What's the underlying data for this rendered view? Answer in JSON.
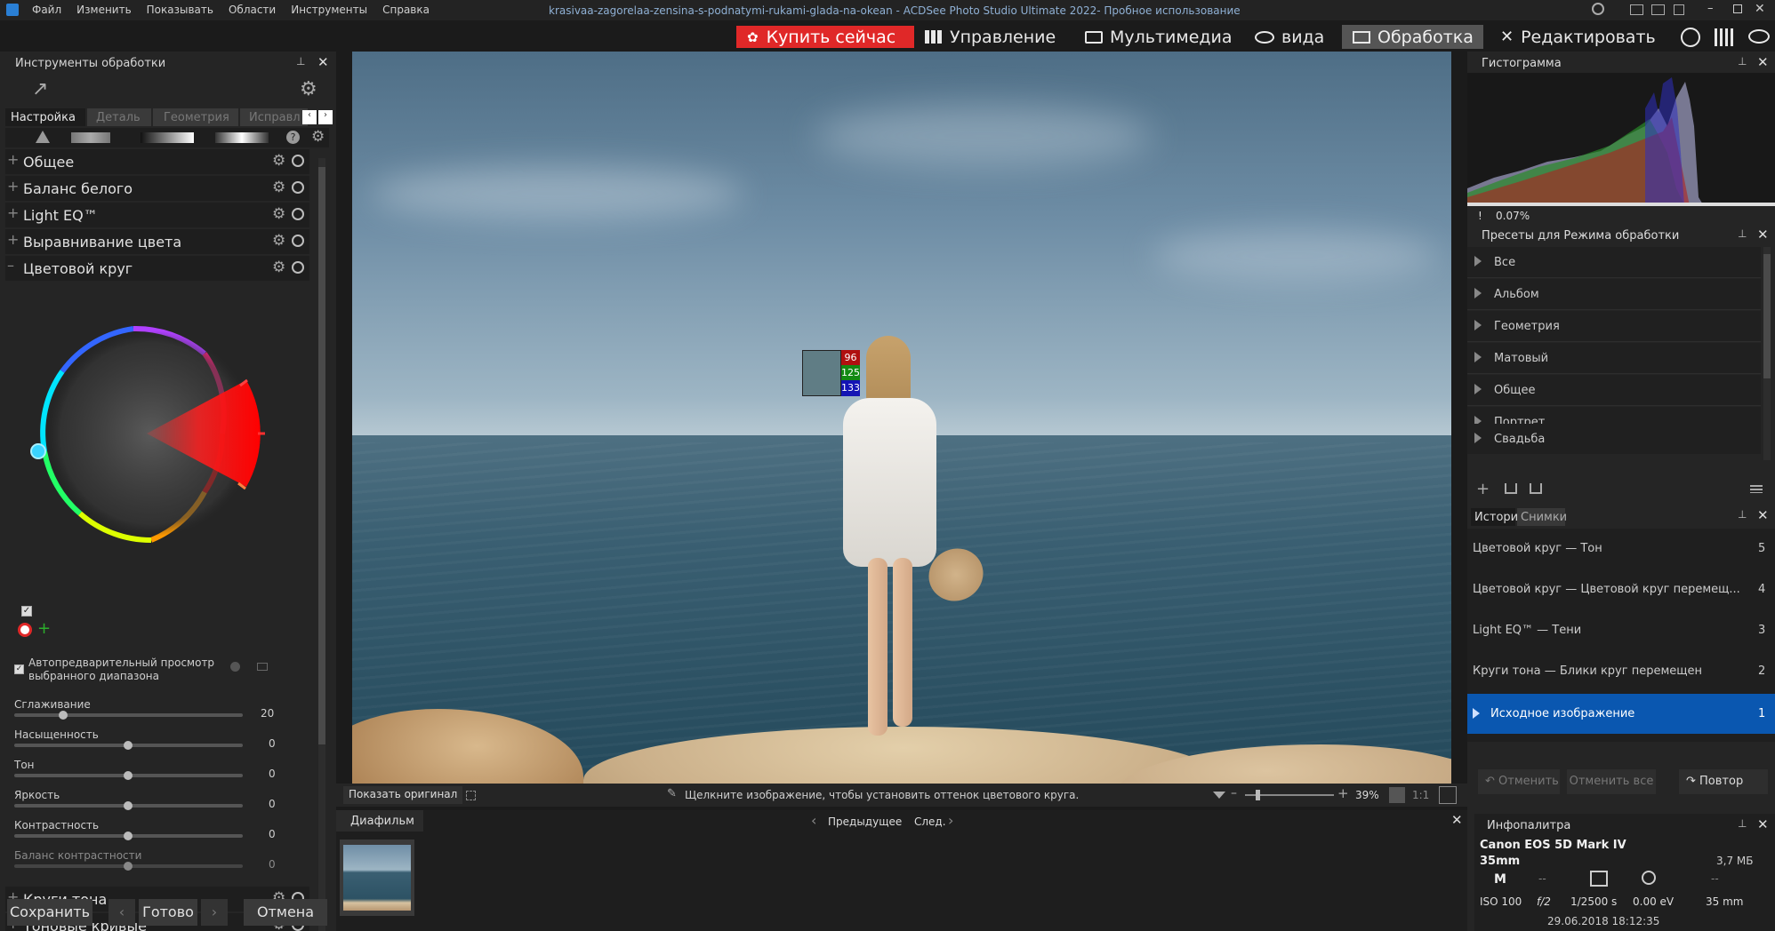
{
  "menu": [
    "Файл",
    "Изменить",
    "Показывать",
    "Области",
    "Инструменты",
    "Справка"
  ],
  "window_title": "krasivaa-zagorelaa-zensina-s-podnatymi-rukami-glada-na-okean - ACDSee Photo Studio Ultimate 2022- Пробное использование",
  "buy": "Купить сейчас",
  "modes": [
    {
      "label": "Управление",
      "active": false
    },
    {
      "label": "Мультимедиа",
      "active": false
    },
    {
      "label": "вида",
      "active": false
    },
    {
      "label": "Обработка",
      "active": true
    },
    {
      "label": "Редактировать",
      "active": false
    }
  ],
  "left": {
    "title": "Инструменты обработки",
    "tabs": [
      "Настройка",
      "Деталь",
      "Геометрия",
      "Исправл"
    ],
    "groups": [
      "Общее",
      "Баланс белого",
      "Light EQ™",
      "Выравнивание цвета",
      "Цветовой круг"
    ],
    "auto_preview": "Автопредварительный просмотр выбранного диапазона",
    "sliders": [
      {
        "label": "Сглаживание",
        "value": 20,
        "max": 100
      },
      {
        "label": "Насыщенность",
        "value": 0,
        "min": -100,
        "max": 100
      },
      {
        "label": "Тон",
        "value": 0,
        "min": -100,
        "max": 100
      },
      {
        "label": "Яркость",
        "value": 0,
        "min": -100,
        "max": 100
      },
      {
        "label": "Контрастность",
        "value": 0,
        "min": -100,
        "max": 100
      },
      {
        "label": "Баланс контрастности",
        "value": 0,
        "min": -100,
        "max": 100
      }
    ],
    "groups_bottom": [
      "Круги тона",
      "Тоновые кривые"
    ],
    "save": "Сохранить",
    "done": "Готово",
    "cancel": "Отмена"
  },
  "center": {
    "show_original": "Показать оригинал",
    "hint": "Щелкните изображение, чтобы установить оттенок цветового круга.",
    "zoom": "39%",
    "ratio": "1:1",
    "rgb": {
      "r": "96",
      "g": "125",
      "b": "133"
    }
  },
  "filmstrip": {
    "tab": "Диафильм",
    "prev": "Предыдущее",
    "next": "След."
  },
  "right": {
    "histogram_title": "Гистограмма",
    "histogram_pct": "0.07%",
    "presets_title": "Пресеты для Режима обработки",
    "presets": [
      "Все",
      "Альбом",
      "Геометрия",
      "Матовый",
      "Общее",
      "Портрет",
      "Свадьба"
    ],
    "history_tabs": [
      "История",
      "Снимки"
    ],
    "history": [
      {
        "label": "Цветовой круг — Тон",
        "n": "5"
      },
      {
        "label": "Цветовой круг — Цветовой круг перемещ...",
        "n": "4"
      },
      {
        "label": "Light EQ™ — Тени",
        "n": "3"
      },
      {
        "label": "Круги тона — Блики круг перемещен",
        "n": "2"
      },
      {
        "label": "Исходное изображение",
        "n": "1"
      }
    ],
    "undo": "Отменить",
    "undo_all": "Отменить все",
    "redo": "Повтор",
    "info_title": "Инфопалитра",
    "camera": "Canon EOS 5D Mark IV",
    "lens": "35mm",
    "size": "3,7 МБ",
    "mode": "M",
    "dash": "--",
    "iso": "ISO 100",
    "aperture": "f/2",
    "shutter": "1/2500 s",
    "ev": "0.00 eV",
    "focal": "35 mm",
    "date": "29.06.2018 18:12:35"
  }
}
